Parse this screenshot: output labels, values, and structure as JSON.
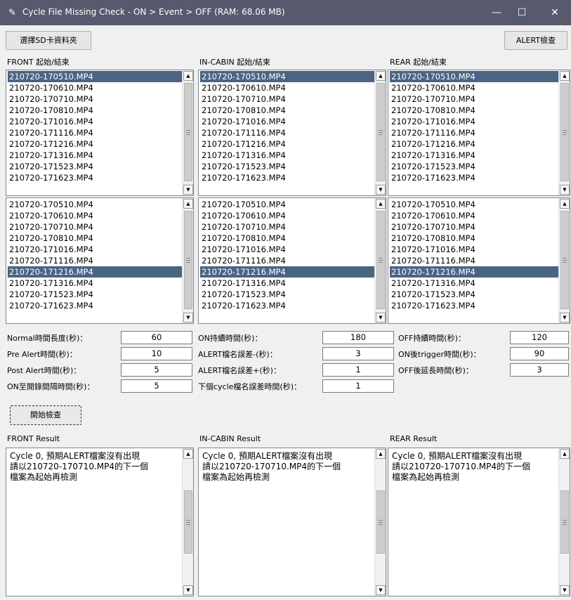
{
  "window": {
    "title": "Cycle File Missing Check - ON > Event > OFF (RAM: 68.06 MB)",
    "icon": "feather-icon",
    "minimize": "—",
    "maximize": "☐",
    "close": "✕"
  },
  "toolbar": {
    "select_sd": "選擇SD卡資料夾",
    "alert_check": "ALERT檢查"
  },
  "columns": [
    {
      "header": "FRONT 起始/結束",
      "result_header": "FRONT Result"
    },
    {
      "header": "IN-CABIN 起始/結束",
      "result_header": "IN-CABIN Result"
    },
    {
      "header": "REAR 起始/結束",
      "result_header": "REAR Result"
    }
  ],
  "files": [
    "210720-170510.MP4",
    "210720-170610.MP4",
    "210720-170710.MP4",
    "210720-170810.MP4",
    "210720-171016.MP4",
    "210720-171116.MP4",
    "210720-171216.MP4",
    "210720-171316.MP4",
    "210720-171523.MP4",
    "210720-171623.MP4"
  ],
  "start_selected_index": 0,
  "end_selected_index": 6,
  "params_left": [
    {
      "label": "Normal時間長度(秒)：",
      "value": "60"
    },
    {
      "label": "Pre Alert時間(秒)：",
      "value": "10"
    },
    {
      "label": "Post Alert時間(秒)：",
      "value": "5"
    },
    {
      "label": "ON至開錄間隔時間(秒)：",
      "value": "5"
    }
  ],
  "params_mid": [
    {
      "label": "ON持續時間(秒)：",
      "value": "180"
    },
    {
      "label": "ALERT檔名誤差-(秒)：",
      "value": "3"
    },
    {
      "label": "ALERT檔名誤差+(秒)：",
      "value": "1"
    },
    {
      "label": "下個cycle檔名誤差時間(秒)：",
      "value": "1"
    }
  ],
  "params_right": [
    {
      "label": "OFF持續時間(秒)：",
      "value": "120"
    },
    {
      "label": "ON後trigger時間(秒)：",
      "value": "90"
    },
    {
      "label": "OFF後延長時間(秒)：",
      "value": "3"
    }
  ],
  "start_button": "開始檢查",
  "result_text": "Cycle 0, 預期ALERT檔案沒有出現\n請以210720-170710.MP4的下一個\n檔案為起始再檢測"
}
